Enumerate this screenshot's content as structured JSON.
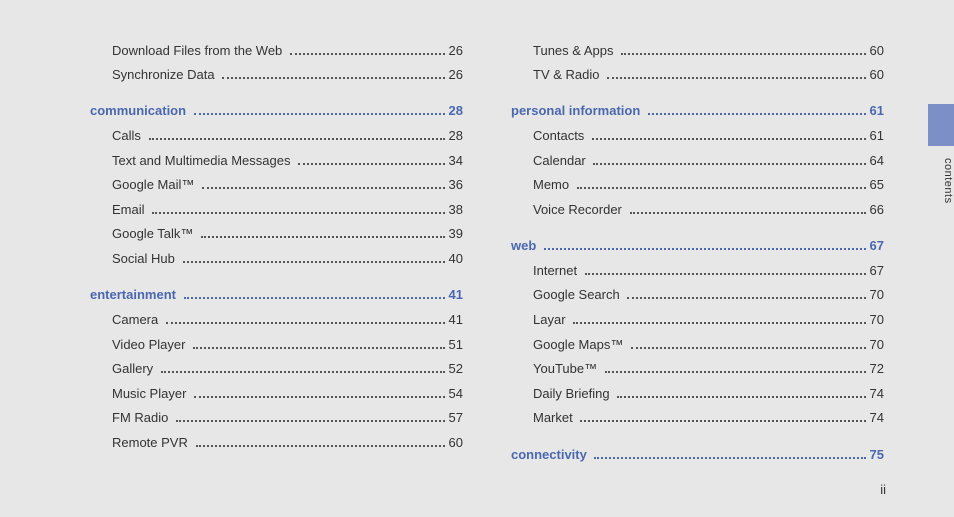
{
  "sideTabLabel": "contents",
  "pageNumber": "ii",
  "columns": [
    [
      {
        "type": "item",
        "label": "Download Files from the Web",
        "page": "26"
      },
      {
        "type": "item",
        "label": "Synchronize Data",
        "page": "26"
      },
      {
        "type": "section",
        "label": "communication",
        "page": "28"
      },
      {
        "type": "item",
        "label": "Calls",
        "page": "28"
      },
      {
        "type": "item",
        "label": "Text and Multimedia Messages",
        "page": "34"
      },
      {
        "type": "item",
        "label": "Google Mail™",
        "page": "36"
      },
      {
        "type": "item",
        "label": "Email",
        "page": "38"
      },
      {
        "type": "item",
        "label": "Google Talk™",
        "page": "39"
      },
      {
        "type": "item",
        "label": "Social Hub",
        "page": "40"
      },
      {
        "type": "section",
        "label": "entertainment",
        "page": "41"
      },
      {
        "type": "item",
        "label": "Camera",
        "page": "41"
      },
      {
        "type": "item",
        "label": "Video Player",
        "page": "51"
      },
      {
        "type": "item",
        "label": "Gallery",
        "page": "52"
      },
      {
        "type": "item",
        "label": "Music Player",
        "page": "54"
      },
      {
        "type": "item",
        "label": "FM Radio",
        "page": "57"
      },
      {
        "type": "item",
        "label": "Remote PVR",
        "page": "60"
      }
    ],
    [
      {
        "type": "item",
        "label": "Tunes & Apps",
        "page": "60"
      },
      {
        "type": "item",
        "label": "TV & Radio",
        "page": "60"
      },
      {
        "type": "section",
        "label": "personal information",
        "page": "61"
      },
      {
        "type": "item",
        "label": "Contacts",
        "page": "61"
      },
      {
        "type": "item",
        "label": "Calendar",
        "page": "64"
      },
      {
        "type": "item",
        "label": "Memo",
        "page": "65"
      },
      {
        "type": "item",
        "label": "Voice Recorder",
        "page": "66"
      },
      {
        "type": "section",
        "label": "web",
        "page": "67"
      },
      {
        "type": "item",
        "label": "Internet",
        "page": "67"
      },
      {
        "type": "item",
        "label": "Google Search",
        "page": "70"
      },
      {
        "type": "item",
        "label": "Layar",
        "page": "70"
      },
      {
        "type": "item",
        "label": "Google Maps™",
        "page": "70"
      },
      {
        "type": "item",
        "label": "YouTube™",
        "page": "72"
      },
      {
        "type": "item",
        "label": "Daily Briefing",
        "page": "74"
      },
      {
        "type": "item",
        "label": "Market",
        "page": "74"
      },
      {
        "type": "section",
        "label": "connectivity",
        "page": "75"
      }
    ]
  ]
}
